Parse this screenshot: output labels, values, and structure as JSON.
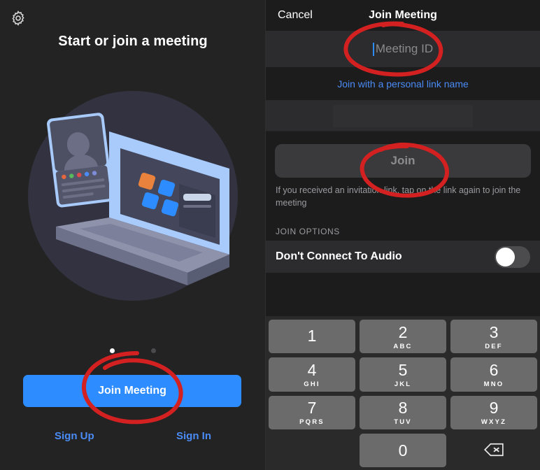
{
  "left": {
    "gear_icon": "gear-icon",
    "title": "Start or join a meeting",
    "join_meeting_label": "Join Meeting",
    "sign_up_label": "Sign Up",
    "sign_in_label": "Sign In",
    "page_dots": {
      "count": 2,
      "active_index": 0
    },
    "accent_blue": "#2d8cff",
    "link_blue": "#4a8bf5",
    "illustration": "laptop-and-phone-illustration"
  },
  "right": {
    "nav": {
      "cancel_label": "Cancel",
      "title": "Join Meeting"
    },
    "meeting_id_field": {
      "placeholder": "Meeting ID",
      "value": "",
      "has_caret": true
    },
    "personal_link": "Join with a personal link name",
    "name_field": {
      "placeholder": "",
      "value": ""
    },
    "join_button": {
      "label": "Join",
      "enabled": false
    },
    "helper_text": "If you received an invitation link, tap on the link again to join the meeting",
    "join_options": {
      "section_label": "JOIN OPTIONS",
      "rows": [
        {
          "label": "Don't Connect To Audio",
          "toggle_on": false
        }
      ]
    },
    "keypad": {
      "keys": [
        {
          "digit": "1",
          "letters": ""
        },
        {
          "digit": "2",
          "letters": "ABC"
        },
        {
          "digit": "3",
          "letters": "DEF"
        },
        {
          "digit": "4",
          "letters": "GHI"
        },
        {
          "digit": "5",
          "letters": "JKL"
        },
        {
          "digit": "6",
          "letters": "MNO"
        },
        {
          "digit": "7",
          "letters": "PQRS"
        },
        {
          "digit": "8",
          "letters": "TUV"
        },
        {
          "digit": "9",
          "letters": "WXYZ"
        },
        {
          "digit": "",
          "letters": ""
        },
        {
          "digit": "0",
          "letters": ""
        },
        {
          "digit": "",
          "letters": "",
          "icon": "backspace-icon"
        }
      ]
    }
  },
  "annotations": {
    "color": "#d32020",
    "marks": [
      {
        "name": "circle-meeting-id-field",
        "shape": "ellipse"
      },
      {
        "name": "circle-join-button",
        "shape": "ellipse"
      },
      {
        "name": "circle-join-meeting-button",
        "shape": "ellipse"
      }
    ]
  }
}
